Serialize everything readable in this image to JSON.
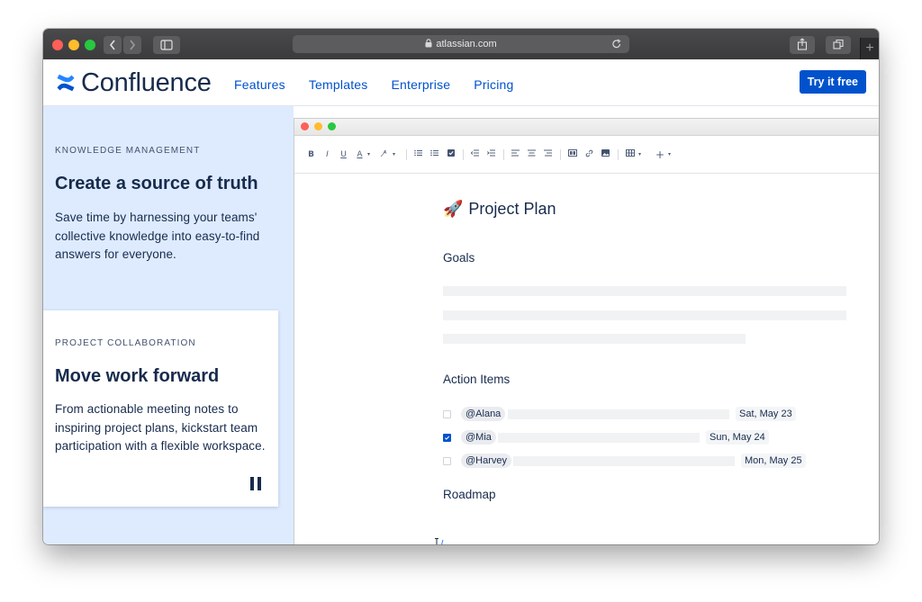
{
  "browser": {
    "url": "atlassian.com"
  },
  "site": {
    "logo_text": "Confluence",
    "nav": [
      "Features",
      "Templates",
      "Enterprise",
      "Pricing"
    ],
    "cta": "Try it free",
    "brand_color": "#0052cc"
  },
  "left": {
    "sec1": {
      "eyebrow": "KNOWLEDGE MANAGEMENT",
      "heading": "Create a source of truth",
      "body": "Save time by harnessing your teams' collective knowledge into easy-to-find answers for everyone."
    },
    "sec2": {
      "eyebrow": "PROJECT COLLABORATION",
      "heading": "Move work forward",
      "body": "From actionable meeting notes to inspiring project plans, kickstart team participation with a flexible workspace."
    }
  },
  "editor": {
    "toolbar": {
      "bold": "B",
      "italic": "I",
      "underline": "U",
      "text_color": "A",
      "more": "+"
    },
    "doc": {
      "title_emoji": "🚀",
      "title": "Project Plan",
      "goals": "Goals",
      "action_items": "Action Items",
      "roadmap": "Roadmap",
      "items": [
        {
          "mention": "@Alana",
          "date": "Sat, May 23",
          "checked": false
        },
        {
          "mention": "@Mia",
          "date": "Sun, May 24",
          "checked": true
        },
        {
          "mention": "@Harvey",
          "date": "Mon, May 25",
          "checked": false
        }
      ]
    }
  }
}
